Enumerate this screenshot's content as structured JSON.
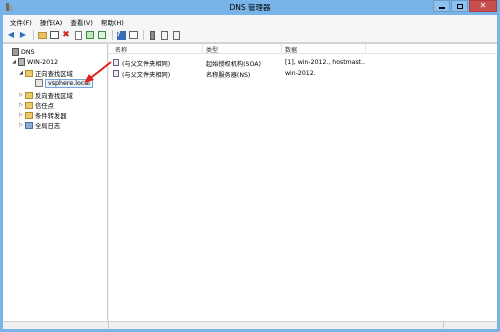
{
  "window": {
    "title": "DNS 管理器"
  },
  "menu": [
    "文件(F)",
    "操作(A)",
    "查看(V)",
    "帮助(H)"
  ],
  "toolbar": {
    "icons": [
      "back-arrow-icon",
      "forward-arrow-icon",
      "up-folder-icon",
      "show-tree-icon",
      "delete-icon",
      "properties-icon",
      "refresh-icon",
      "export-icon",
      "help-icon",
      "list-view-icon",
      "server-icon",
      "record-icon"
    ]
  },
  "tree": {
    "root": "DNS",
    "server": "WIN-2012",
    "forward_zones": "正向查找区域",
    "zone": "vsphere.local",
    "reverse_zones": "反向查找区域",
    "trust_points": "信任点",
    "conditional_forwarders": "条件转发器",
    "global_logs": "全局日志"
  },
  "list": {
    "columns": [
      "名称",
      "类型",
      "数据"
    ],
    "rows": [
      {
        "name": "(与父文件夹相同)",
        "type": "起始授权机构(SOA)",
        "data": "[1], win-2012., hostmast..."
      },
      {
        "name": "(与父文件夹相同)",
        "type": "名称服务器(NS)",
        "data": "win-2012."
      }
    ]
  },
  "colors": {
    "titlebar": "#78b4e8",
    "annotation_arrow": "#e02020"
  }
}
